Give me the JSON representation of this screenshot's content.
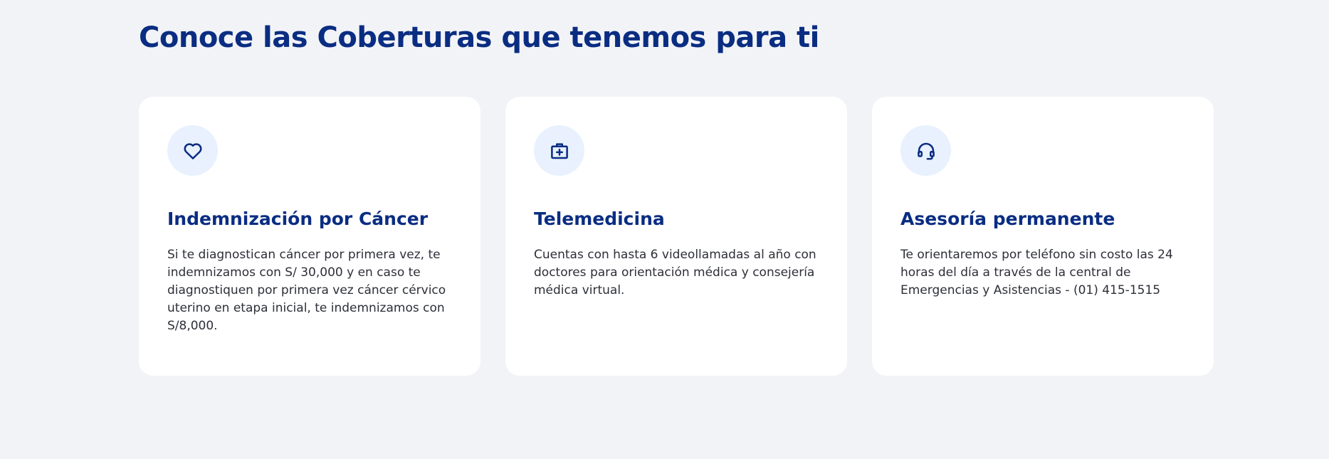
{
  "section": {
    "title": "Conoce las Coberturas que tenemos para ti"
  },
  "cards": [
    {
      "icon": "heart-icon",
      "title": "Indemnización por Cáncer",
      "text": "Si te diagnostican cáncer por primera vez, te indemnizamos con S/ 30,000 y en caso te diagnostiquen por primera vez cáncer cérvico uterino en etapa inicial, te indemnizamos con S/8,000."
    },
    {
      "icon": "medical-kit-icon",
      "title": "Telemedicina",
      "text": "Cuentas con hasta 6 videollamadas al año con doctores para orientación médica y consejería médica virtual."
    },
    {
      "icon": "headset-icon",
      "title": "Asesoría permanente",
      "text": "Te orientaremos por teléfono sin costo las 24 horas del día a través de la central de Emergencias y Asistencias - (01) 415-1515"
    }
  ],
  "colors": {
    "background": "#f2f3f7",
    "brand_blue": "#0a2d82",
    "icon_bg": "#e8f1fd",
    "card_bg": "#ffffff",
    "body_text": "#2d2f38"
  }
}
